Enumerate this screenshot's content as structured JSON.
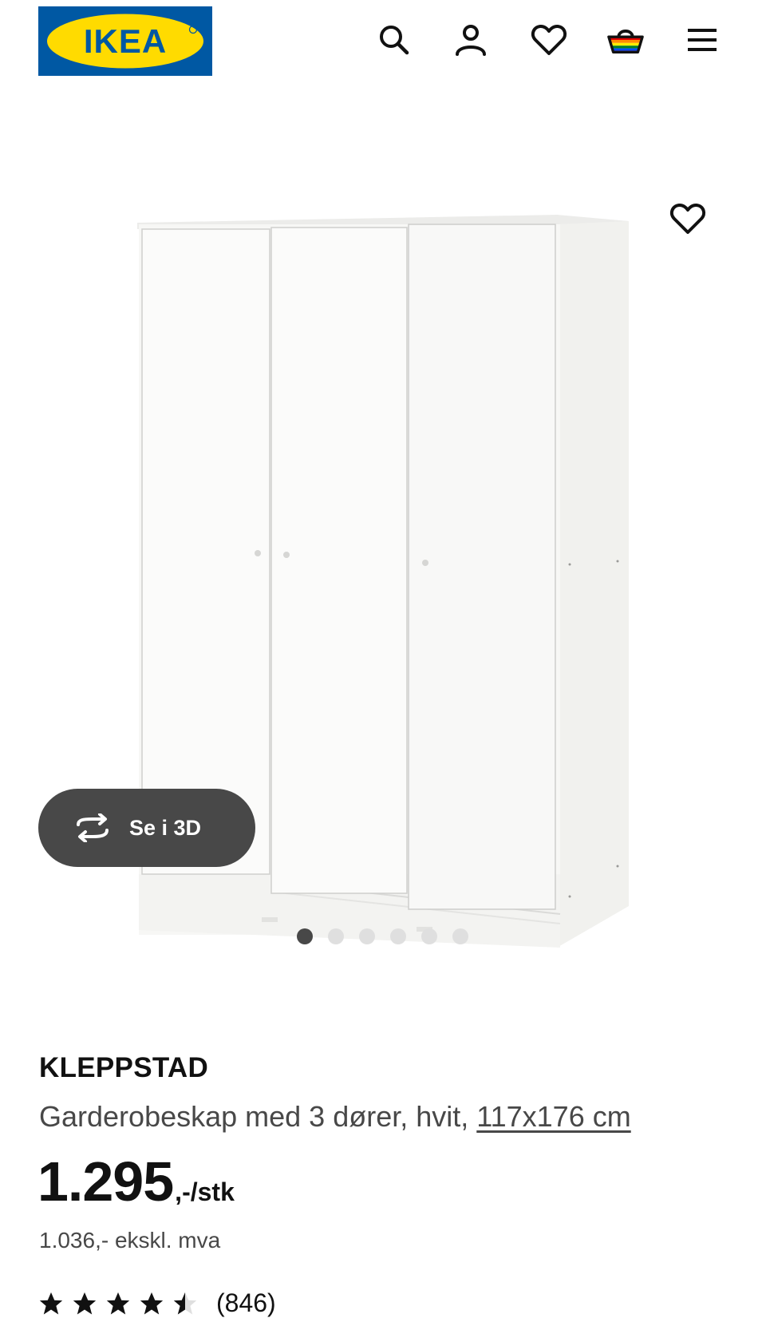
{
  "header": {
    "logo_text": "IKEA",
    "icons": [
      "search-icon",
      "account-icon",
      "favorites-heart-icon",
      "shopping-basket-icon",
      "menu-hamburger-icon"
    ]
  },
  "gallery": {
    "view3d_label": "Se i 3D",
    "image_count": 6,
    "active_index": 0
  },
  "product": {
    "name": "KLEPPSTAD",
    "description": "Garderobeskap med 3 dører, hvit, ",
    "measurement": "117x176 cm",
    "price_integer": "1.295",
    "price_suffix": ",-/stk",
    "price_excl_vat": "1.036,- ekskl. mva",
    "rating_value": 4.5,
    "rating_count": "(846)"
  },
  "colors": {
    "ikea_blue": "#0058a3",
    "ikea_yellow": "#ffdb00",
    "dark_button": "#484848",
    "dot_inactive": "#dfdfdf"
  }
}
